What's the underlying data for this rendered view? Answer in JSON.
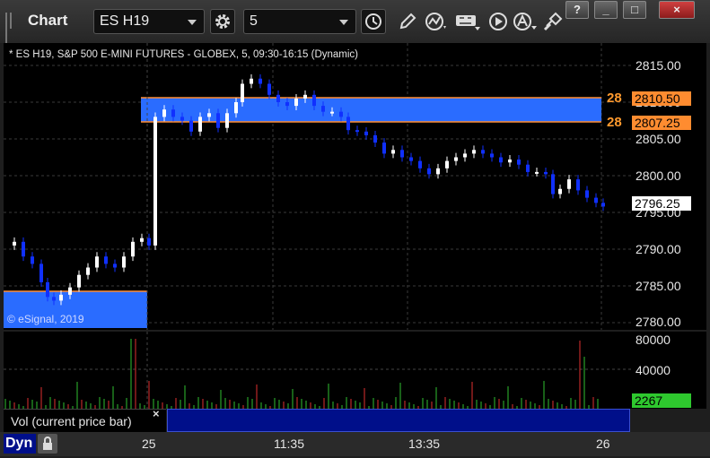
{
  "app": {
    "title": "Chart"
  },
  "toolbar": {
    "symbol": "ES H19",
    "interval": "5",
    "window_buttons": [
      "?",
      "_",
      "□",
      "×"
    ]
  },
  "chart": {
    "info": "* ES H19, S&P 500 E-MINI FUTURES - GLOBEX, 5, 09:30-16:15 (Dynamic)",
    "copyright": "© eSignal, 2019",
    "price_axis": [
      "2815.00",
      "2810.00",
      "2805.00",
      "2800.00",
      "2795.00",
      "2790.00",
      "2785.00",
      "2780.00"
    ],
    "alert_high": {
      "tag": "28",
      "price": "2810.50"
    },
    "alert_low": {
      "tag": "28",
      "price": "2807.25"
    },
    "last_price": "2796.25",
    "colors": {
      "up": "#ffffff",
      "down": "#1030ff",
      "zone": "#2a6cff",
      "alert": "#ff8c30"
    }
  },
  "volume": {
    "axis": [
      "80000",
      "40000"
    ],
    "current": "2267",
    "legend": "Vol (current price bar)",
    "close_glyph": "×"
  },
  "timebar": {
    "dyn_label": "Dyn",
    "labels": [
      "25",
      "11:35",
      "13:35",
      "26"
    ]
  }
}
